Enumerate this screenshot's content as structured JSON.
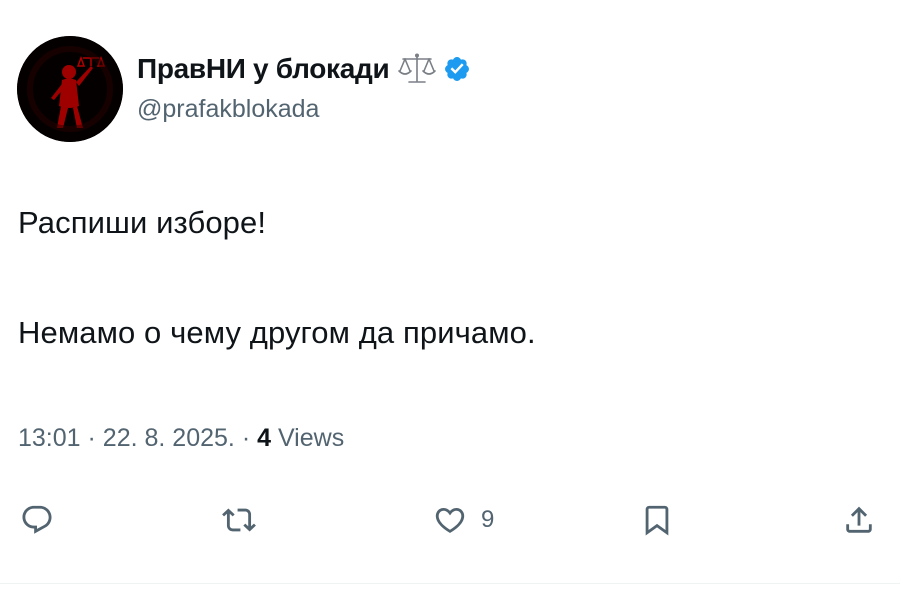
{
  "tweet": {
    "author": {
      "display_name": "ПравНИ у блокади",
      "handle": "@prafakblokada",
      "name_emoji_icon": "balance-scale-icon",
      "verified_icon": "verified-badge-icon",
      "verified_color": "#1d9bf0"
    },
    "text_lines": [
      "Распиши изборе!",
      "Немамо о чему другом да причамо."
    ],
    "meta": {
      "time": "13:01",
      "separator": "·",
      "date": "22. 8. 2025.",
      "views_count": "4",
      "views_label": "Views"
    },
    "actions": {
      "reply_icon": "reply-icon",
      "retweet_icon": "retweet-icon",
      "like_icon": "heart-icon",
      "like_count": "9",
      "bookmark_icon": "bookmark-icon",
      "share_icon": "share-icon"
    },
    "colors": {
      "text": "#0f1419",
      "secondary": "#536471",
      "accent": "#1d9bf0"
    }
  }
}
